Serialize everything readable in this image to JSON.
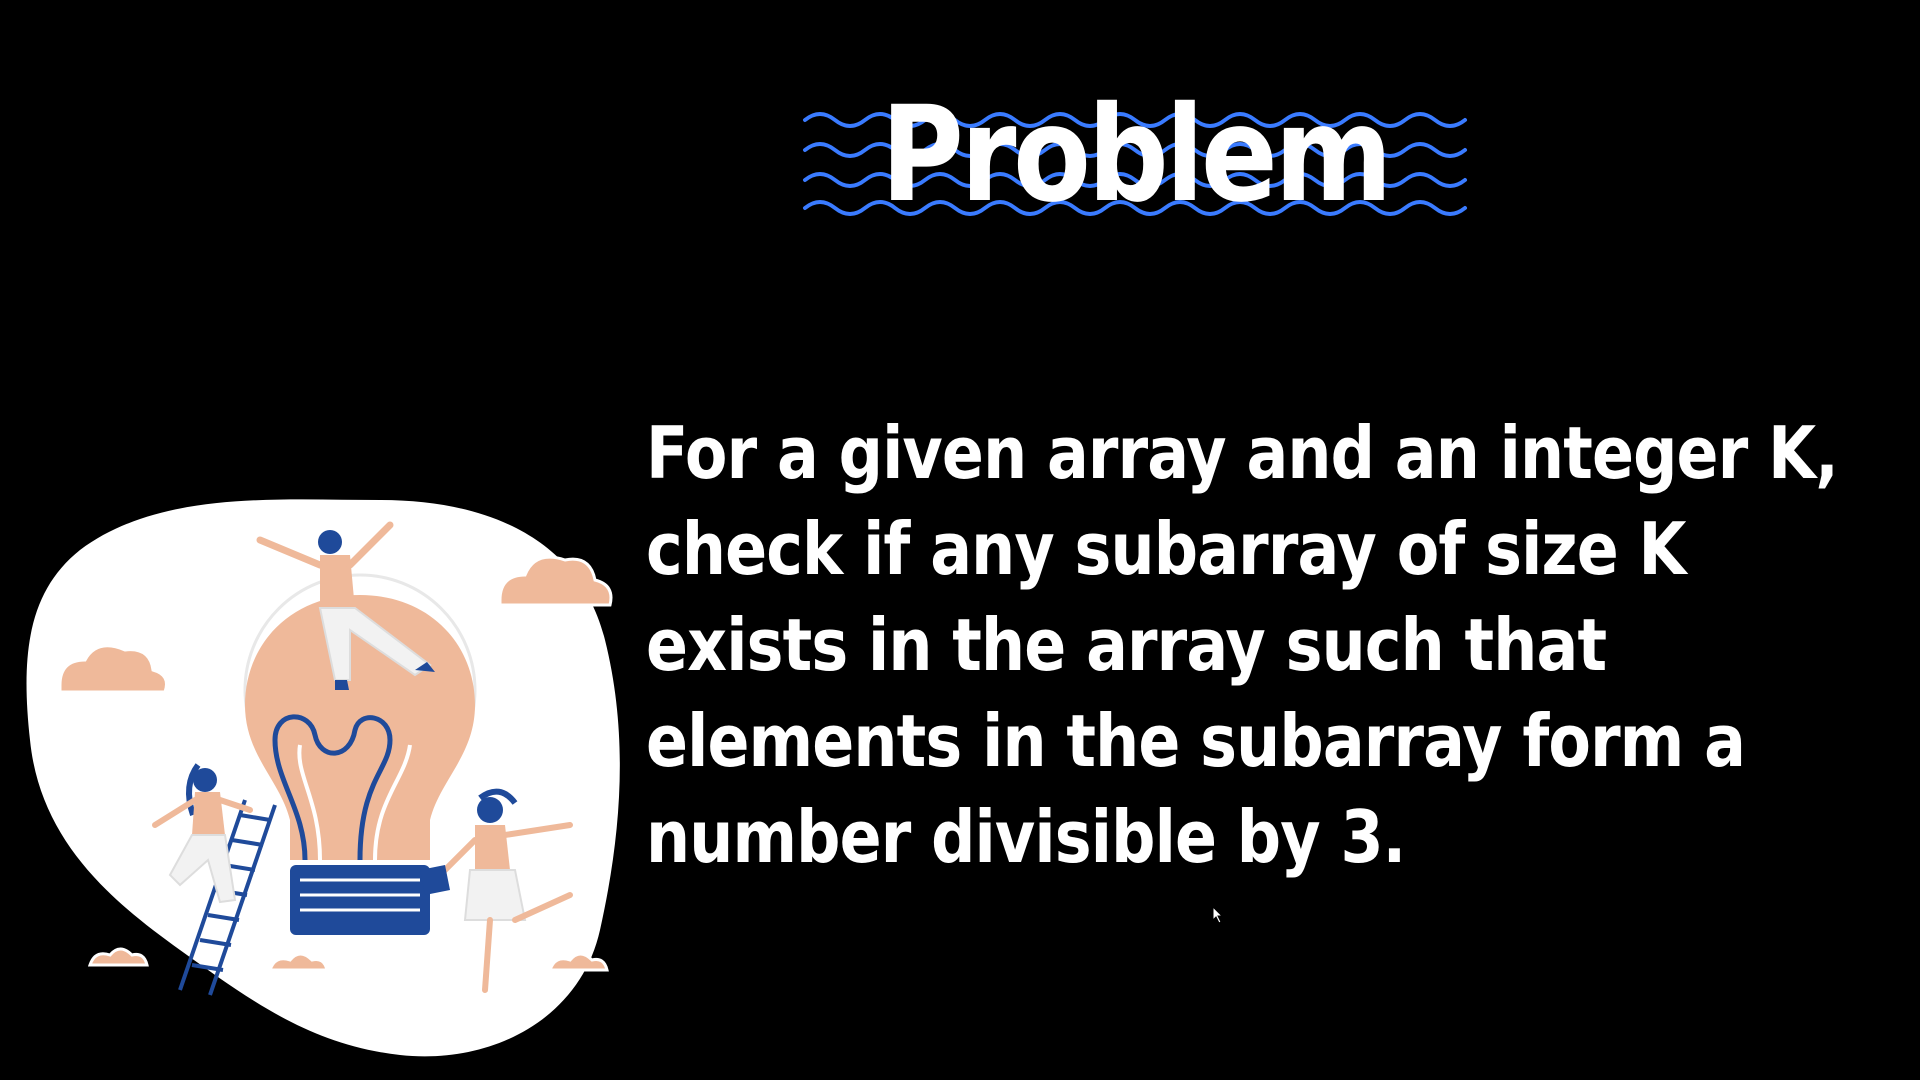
{
  "slide": {
    "title": "Problem",
    "body_lines": [
      "For a given array and an integer K,",
      "check if any subarray of size K",
      "exists in the array such that",
      "elements in the subarray form a",
      "number divisible by 3."
    ]
  },
  "colors": {
    "background": "#000000",
    "text": "#ffffff",
    "wave_accent": "#3a7bff",
    "illustration_peach": "#efb99a",
    "illustration_navy": "#1f4a9a",
    "illustration_blob": "#ffffff"
  },
  "icons": {
    "illustration": "lightbulb-people-illustration",
    "title_decoration": "wavy-lines",
    "cursor": "mouse-pointer"
  }
}
